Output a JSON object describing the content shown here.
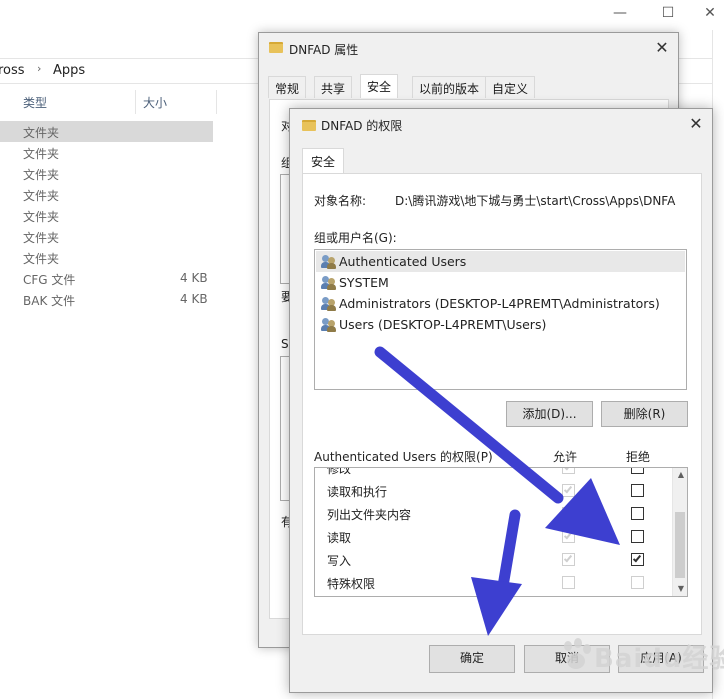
{
  "explorer": {
    "breadcrumb": [
      "ross",
      "Apps"
    ],
    "columns": {
      "type": "类型",
      "size": "大小"
    },
    "rows": [
      {
        "type": "文件夹",
        "size": "",
        "selected": true
      },
      {
        "type": "文件夹",
        "size": ""
      },
      {
        "type": "文件夹",
        "size": ""
      },
      {
        "type": "文件夹",
        "size": ""
      },
      {
        "type": "文件夹",
        "size": ""
      },
      {
        "type": "文件夹",
        "size": ""
      },
      {
        "type": "文件夹",
        "size": ""
      },
      {
        "type": "CFG 文件",
        "size": "4 KB"
      },
      {
        "type": "BAK 文件",
        "size": "4 KB"
      }
    ]
  },
  "properties_dialog": {
    "title": "DNFAD 属性",
    "tabs": [
      "常规",
      "共享",
      "安全",
      "以前的版本",
      "自定义"
    ],
    "active_tab": "安全",
    "peek_texts": [
      "对",
      "组",
      "要",
      "S",
      "有"
    ]
  },
  "permissions_dialog": {
    "title": "DNFAD 的权限",
    "tab": "安全",
    "object_label": "对象名称:",
    "object_value": "D:\\腾讯游戏\\地下城与勇士\\start\\Cross\\Apps\\DNFA",
    "group_label": "组或用户名(G):",
    "users": [
      {
        "name": "Authenticated Users",
        "selected": true
      },
      {
        "name": "SYSTEM"
      },
      {
        "name": "Administrators (DESKTOP-L4PREMT\\Administrators)"
      },
      {
        "name": "Users (DESKTOP-L4PREMT\\Users)"
      }
    ],
    "add_button": "添加(D)...",
    "remove_button": "删除(R)",
    "perm_label": "Authenticated Users 的权限(P)",
    "allow_header": "允许",
    "deny_header": "拒绝",
    "permissions": [
      {
        "name": "修改",
        "allow": true,
        "deny": false
      },
      {
        "name": "读取和执行",
        "allow": true,
        "deny": false
      },
      {
        "name": "列出文件夹内容",
        "allow": true,
        "deny": false
      },
      {
        "name": "读取",
        "allow": true,
        "deny": false
      },
      {
        "name": "写入",
        "allow": true,
        "deny": true
      },
      {
        "name": "特殊权限",
        "allow": false,
        "deny": false
      }
    ],
    "ok_button": "确定",
    "cancel_button": "取消",
    "apply_button": "应用(A)"
  },
  "watermark": "Baidu经验",
  "colors": {
    "arrow": "#3d3fd0",
    "selection": "#d9d9d9",
    "dialog_bg": "#f0f0f0"
  }
}
